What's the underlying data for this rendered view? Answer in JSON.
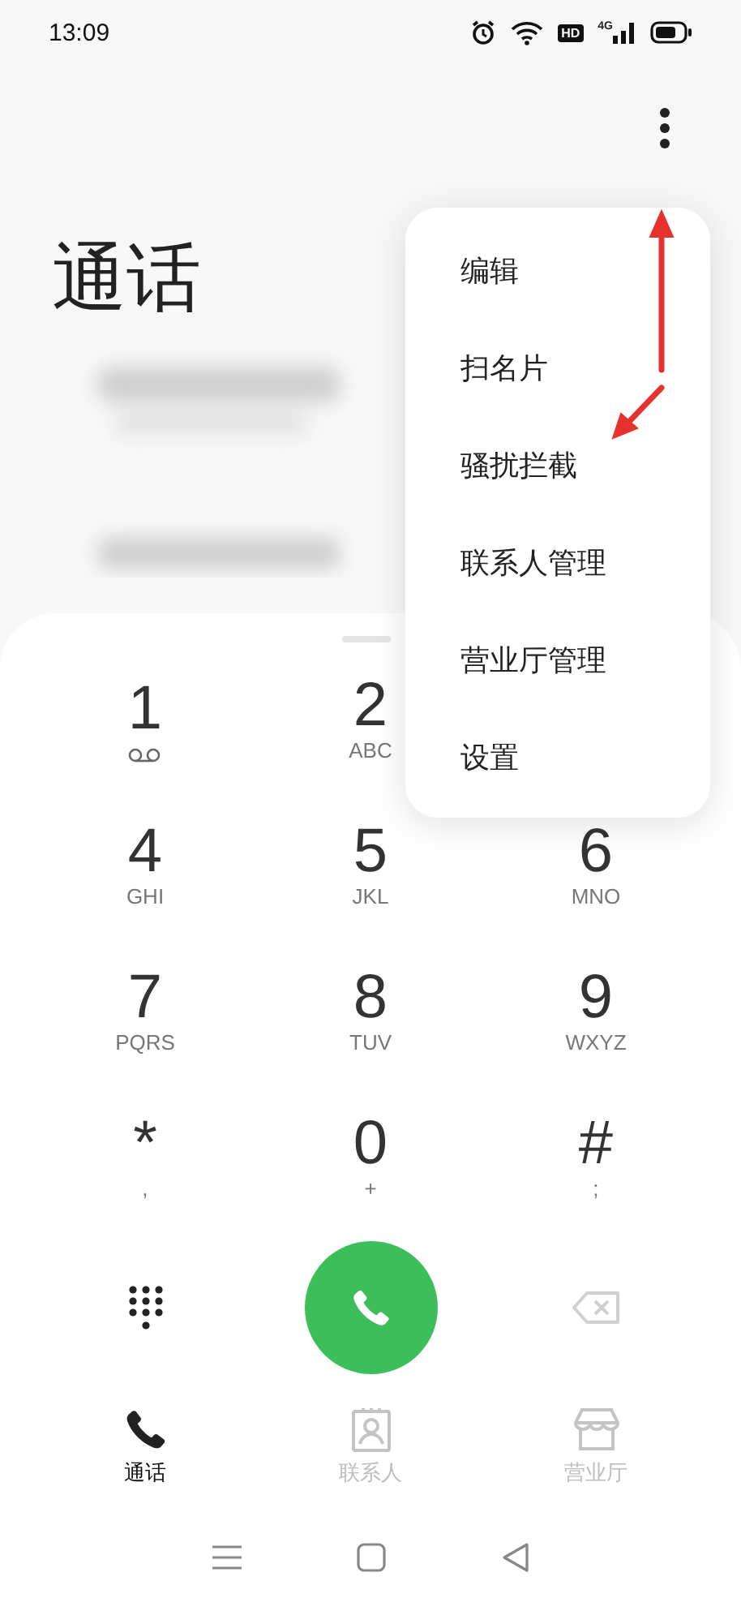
{
  "status_bar": {
    "time": "13:09",
    "hd_label": "HD",
    "network_label": "4G"
  },
  "title": "通话",
  "menu": {
    "items": [
      "编辑",
      "扫名片",
      "骚扰拦截",
      "联系人管理",
      "营业厅管理",
      "设置"
    ]
  },
  "keypad": {
    "rows": [
      [
        {
          "digit": "1",
          "kind": "voicemail"
        },
        {
          "digit": "2",
          "kind": "text",
          "sub": "ABC"
        }
      ],
      [
        {
          "digit": "4",
          "kind": "text",
          "sub": "GHI"
        },
        {
          "digit": "5",
          "kind": "text",
          "sub": "JKL"
        },
        {
          "digit": "6",
          "kind": "text",
          "sub": "MNO"
        }
      ],
      [
        {
          "digit": "7",
          "kind": "text",
          "sub": "PQRS"
        },
        {
          "digit": "8",
          "kind": "text",
          "sub": "TUV"
        },
        {
          "digit": "9",
          "kind": "text",
          "sub": "WXYZ"
        }
      ],
      [
        {
          "digit": "*",
          "kind": "text",
          "sub": ","
        },
        {
          "digit": "0",
          "kind": "text",
          "sub": "+"
        },
        {
          "digit": "#",
          "kind": "text",
          "sub": ";"
        }
      ]
    ]
  },
  "tabs": [
    {
      "label": "通话",
      "kind": "phone",
      "selected": true
    },
    {
      "label": "联系人",
      "kind": "contacts",
      "selected": false
    },
    {
      "label": "营业厅",
      "kind": "store",
      "selected": false
    }
  ]
}
